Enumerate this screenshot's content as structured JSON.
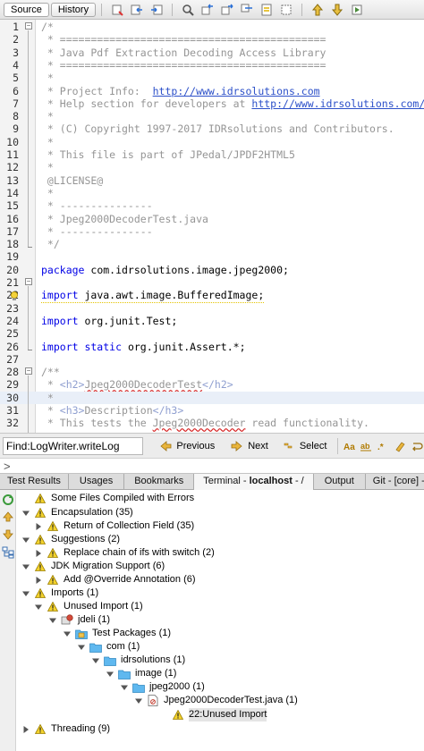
{
  "toolbar": {
    "source_tab": "Source",
    "history_tab": "History"
  },
  "editor": {
    "lines": [
      {
        "n": "1",
        "t": "/*",
        "c": "cm"
      },
      {
        "n": "2",
        "t": " * ===========================================",
        "c": "cm"
      },
      {
        "n": "3",
        "t": " * Java Pdf Extraction Decoding Access Library",
        "c": "cm"
      },
      {
        "n": "4",
        "t": " * ===========================================",
        "c": "cm"
      },
      {
        "n": "5",
        "t": " *",
        "c": "cm"
      },
      {
        "n": "6",
        "t": " * Project Info:  ",
        "c": "cm",
        "link": "http://www.idrsolutions.com"
      },
      {
        "n": "7",
        "t": " * Help section for developers at ",
        "c": "cm",
        "link": "http://www.idrsolutions.com/su"
      },
      {
        "n": "8",
        "t": " *",
        "c": "cm"
      },
      {
        "n": "9",
        "t": " * (C) Copyright 1997-2017 IDRsolutions and Contributors.",
        "c": "cm"
      },
      {
        "n": "10",
        "t": " *",
        "c": "cm"
      },
      {
        "n": "11",
        "t": " * This file is part of JPedal/JPDF2HTML5",
        "c": "cm"
      },
      {
        "n": "12",
        "t": " *",
        "c": "cm"
      },
      {
        "n": "13",
        "t": " @LICENSE@",
        "c": "cm"
      },
      {
        "n": "14",
        "t": " *",
        "c": "cm"
      },
      {
        "n": "15",
        "t": " * ---------------",
        "c": "cm"
      },
      {
        "n": "16",
        "t": " * Jpeg2000DecoderTest.java",
        "c": "cm"
      },
      {
        "n": "17",
        "t": " * ---------------",
        "c": "cm"
      },
      {
        "n": "18",
        "t": " */",
        "c": "cm"
      },
      {
        "n": "19",
        "t": "",
        "c": ""
      },
      {
        "n": "20",
        "t": "",
        "c": "",
        "kw": "package",
        "rest": " com.idrsolutions.image.jpeg2000;"
      },
      {
        "n": "21",
        "t": "",
        "c": ""
      },
      {
        "n": "22",
        "t": "",
        "c": "",
        "kw": "import",
        "rest": " java.awt.image.BufferedImage;"
      },
      {
        "n": "23",
        "t": "",
        "c": ""
      },
      {
        "n": "24",
        "t": "",
        "c": "",
        "kw": "import",
        "rest": " org.junit.Test;"
      },
      {
        "n": "25",
        "t": "",
        "c": ""
      },
      {
        "n": "26",
        "t": "",
        "c": "",
        "kw": "import static",
        "rest": " org.junit.Assert.*;"
      },
      {
        "n": "27",
        "t": "",
        "c": ""
      },
      {
        "n": "28",
        "t": "/**",
        "c": "cm"
      },
      {
        "n": "29",
        "t": "",
        "c": "",
        "doc29": true
      },
      {
        "n": "30",
        "t": " *",
        "c": "cm"
      },
      {
        "n": "31",
        "t": "",
        "c": "",
        "doc31": true
      },
      {
        "n": "32",
        "t": "",
        "c": "",
        "doc32": true
      }
    ],
    "doc": {
      "star": " * ",
      "h2_open": "<h2>",
      "h2_text": "Jpeg2000DecoderTest",
      "h2_close": "</h2>",
      "h3_open": "<h3>",
      "h3_text": "Description",
      "h3_close": "</h3>",
      "l32_a": " * This tests the ",
      "l32_b": "Jpeg2000Decoder",
      "l32_c": " read functionality."
    }
  },
  "findbar": {
    "value": "Find:LogWriter.writeLog",
    "previous": "Previous",
    "next": "Next",
    "select": "Select"
  },
  "cmd": {
    "prompt": ">"
  },
  "tabs": {
    "t1": "Test Results",
    "t2": "Usages",
    "t3": "Bookmarks",
    "t4a": "Terminal - ",
    "t4b": "localhost",
    "t4c": " - /",
    "t5": "Output",
    "t6": "Git - [core] -"
  },
  "hints": {
    "rows": [
      {
        "label": "Some Files Compiled with Errors"
      },
      {
        "label": "Encapsulation (35)"
      },
      {
        "label": "Return of Collection Field (35)"
      },
      {
        "label": "Suggestions (2)"
      },
      {
        "label": "Replace chain of ifs with switch (2)"
      },
      {
        "label": "JDK Migration Support (6)"
      },
      {
        "label": "Add @Override Annotation (6)"
      },
      {
        "label": "Imports (1)"
      },
      {
        "label": "Unused Import (1)"
      },
      {
        "label": "jdeli (1)"
      },
      {
        "label": "Test Packages (1)"
      },
      {
        "label": "com (1)"
      },
      {
        "label": "idrsolutions (1)"
      },
      {
        "label": "image (1)"
      },
      {
        "label": "jpeg2000 (1)"
      },
      {
        "label": "Jpeg2000DecoderTest.java (1)"
      },
      {
        "label": "22:Unused Import"
      },
      {
        "label": "Threading (9)"
      }
    ]
  },
  "colors": {
    "warning": "#f3d22c",
    "folder": "#5fb8ef",
    "keyword": "#0000e6",
    "comment": "#959595",
    "link": "#2c50c9"
  },
  "icons": [
    "back-icon",
    "forward-icon",
    "search-icon",
    "prev-occurrence-icon",
    "next-occurrence-icon",
    "toggle-highlight-icon",
    "bookmark-icon",
    "warning-icon",
    "folder-icon",
    "project-icon",
    "java-file-icon",
    "refresh-icon"
  ]
}
